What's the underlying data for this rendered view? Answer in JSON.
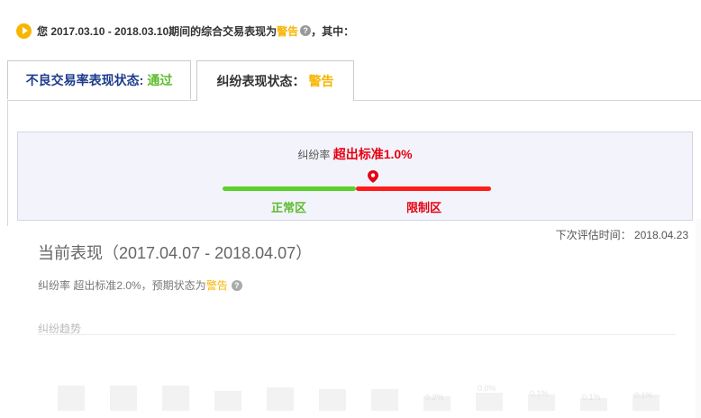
{
  "header": {
    "prefix": "您 2017.03.10 - 2018.03.10期间的综合交易表现为",
    "status": "警告",
    "suffix": "，其中："
  },
  "tabs": [
    {
      "label": "不良交易率表现状态:",
      "value": "通过"
    },
    {
      "label": "纠纷表现状态：",
      "value": "警告"
    }
  ],
  "gauge": {
    "rate_label": "纠纷率",
    "rate_value": "超出标准1.0%",
    "zone_normal": "正常区",
    "zone_limit": "限制区",
    "colors": {
      "normal": "#5cd12b",
      "limit": "#ff1c1c"
    }
  },
  "next_eval": "下次评估时间： 2018.04.23",
  "current": {
    "title": "当前表现（2017.04.07 - 2018.04.07）",
    "expect_prefix": "纠纷率 超出标准2.0%，预期状态为",
    "expect_status": "警告"
  },
  "trend": {
    "label": "纠纷趋势",
    "faded_values": [
      "0.2%",
      "0.0%",
      "0.1%",
      "0.1%",
      "0.1%"
    ]
  }
}
